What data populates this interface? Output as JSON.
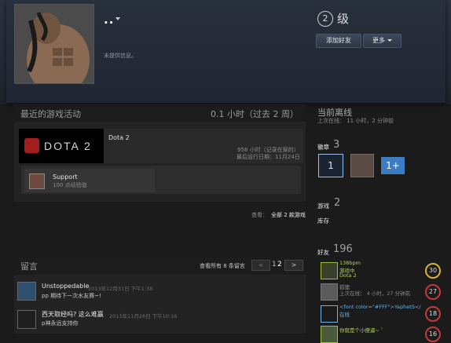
{
  "profile": {
    "persona": "..",
    "summary": "未提供信息。",
    "level_number": "2",
    "level_label": "级",
    "add_friend_label": "添加好友",
    "more_label": "更多"
  },
  "activity": {
    "title": "最近的游戏活动",
    "hours_recent": "0.1 小时（过去 2 周）",
    "game": {
      "banner_text": "DOTA 2",
      "name": "Dota 2",
      "hours_on_record": "958 小时（记录在案的）",
      "last_played": "最后运行日期：11月24日"
    },
    "achievement": {
      "name": "Support",
      "exp": "100 点经验值"
    },
    "view_all_prefix": "查看：",
    "view_all_link": "全部 2 款游戏"
  },
  "comments": {
    "title": "留言",
    "view_all": "查看所有 8 条留言",
    "prev": "<",
    "pages": [
      "1",
      "2"
    ],
    "next": ">",
    "items": [
      {
        "author": "Unstoppedable",
        "time": "2013年12月31日 下午1:38",
        "text": "pp 期待下一次水友赛~!"
      },
      {
        "author": "西天取经吗? 这么难赢",
        "time": "2013年11月26日 下午10:16",
        "text": "p神永远支持你"
      }
    ]
  },
  "sidebar": {
    "status_title": "当前离线",
    "last_online": "上次在线： 11 小时，2 分钟前",
    "badges_label": "徽章",
    "badges_count": "3",
    "badge_level_1": "1",
    "badge_level_3": "1+",
    "games_label": "游戏",
    "games_count": "2",
    "inventory_label": "库存",
    "friends_label": "好友",
    "friends_count": "196",
    "friends": [
      {
        "name": "138bpm",
        "status1": "游戏中",
        "status2": "Dota 2",
        "level": "30",
        "color": "#b6d25b",
        "ring": "#d6b233"
      },
      {
        "name": "狐狸",
        "status1": "上次在线： 4 小时，27 分钟前",
        "status2": "",
        "level": "27",
        "color": "#8c8c8c",
        "ring": "#c23a3a"
      },
      {
        "name": "<font color=\"#FFF\">YaphetS</",
        "status1": "在线",
        "status2": "",
        "level": "18",
        "color": "#6fb2e6",
        "ring": "#c23a3a"
      },
      {
        "name": "你就是个小傻逼~ ﾟ",
        "status1": "",
        "status2": "",
        "level": "16",
        "color": "#b6d25b",
        "ring": "#c23a3a"
      }
    ]
  }
}
